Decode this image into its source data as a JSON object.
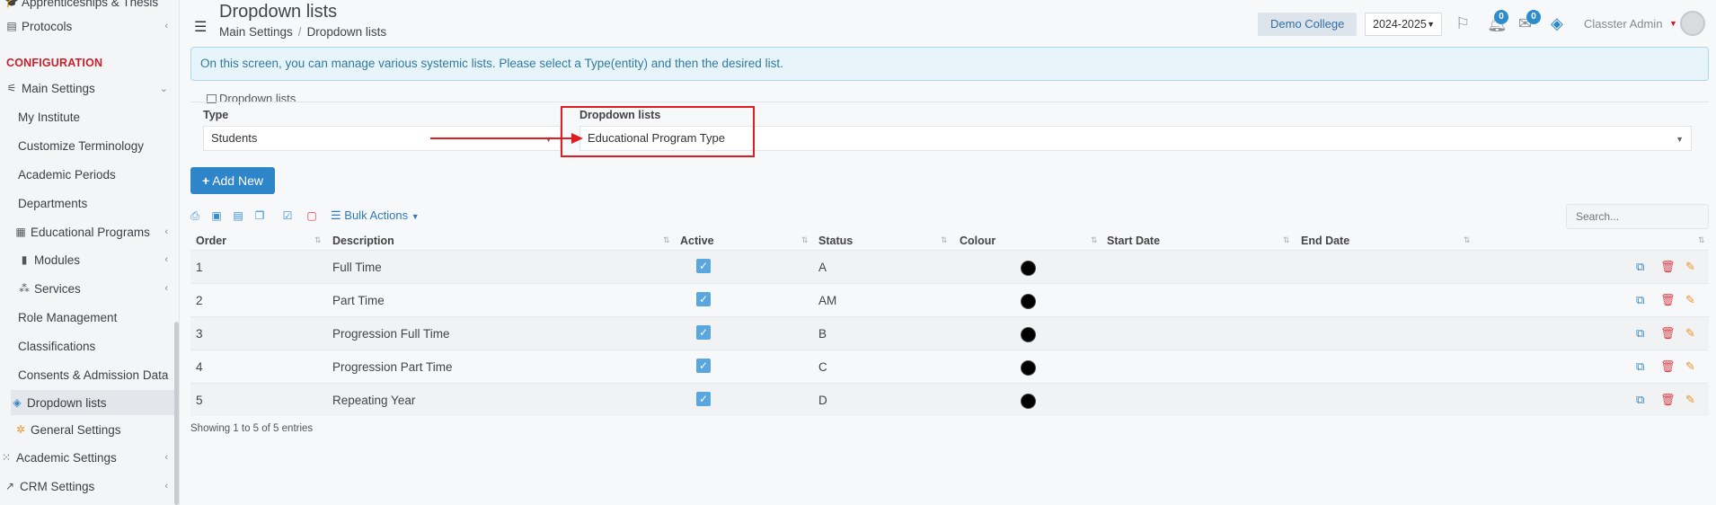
{
  "sidebar": {
    "items": [
      {
        "label": "Apprenticeships & Thesis",
        "icon": "graduation-cap-icon"
      },
      {
        "label": "Protocols",
        "icon": "building-icon"
      },
      {
        "label": "Main Settings",
        "icon": "sliders-icon"
      },
      {
        "label": "My Institute"
      },
      {
        "label": "Customize Terminology"
      },
      {
        "label": "Academic Periods"
      },
      {
        "label": "Departments"
      },
      {
        "label": "Educational Programs",
        "icon": "table-icon"
      },
      {
        "label": "Modules",
        "icon": "book-icon"
      },
      {
        "label": "Services",
        "icon": "nodes-icon"
      },
      {
        "label": "Role Management"
      },
      {
        "label": "Classifications"
      },
      {
        "label": "Consents & Admission Data"
      },
      {
        "label": "Dropdown lists",
        "icon": "layers-icon"
      },
      {
        "label": "General Settings",
        "icon": "cogs-icon"
      },
      {
        "label": "Academic Settings",
        "icon": "grid-icon"
      },
      {
        "label": "CRM Settings",
        "icon": "chart-icon"
      }
    ],
    "section_heading": "CONFIGURATION"
  },
  "header": {
    "title": "Dropdown lists",
    "breadcrumb": [
      "Main Settings",
      "Dropdown lists"
    ],
    "college": "Demo College",
    "year": "2024-2025",
    "notif_count": "0",
    "mail_count": "0",
    "user": "Classter Admin"
  },
  "info": "On this screen, you can manage various systemic lists. Please select a Type(entity) and then the desired list.",
  "panel": {
    "label": "Dropdown lists",
    "type_label": "Type",
    "type_value": "Students",
    "list_label": "Dropdown lists",
    "list_value": "Educational Program Type"
  },
  "actions": {
    "add_new": "Add New",
    "bulk": "Bulk Actions",
    "search_placeholder": "Search..."
  },
  "table": {
    "headers": [
      "Order",
      "Description",
      "Active",
      "Status",
      "Colour",
      "Start Date",
      "End Date"
    ],
    "rows": [
      {
        "order": "1",
        "description": "Full Time",
        "active": true,
        "status": "A",
        "colour": "#000000"
      },
      {
        "order": "2",
        "description": "Part Time",
        "active": true,
        "status": "AM",
        "colour": "#000000"
      },
      {
        "order": "3",
        "description": "Progression Full Time",
        "active": true,
        "status": "B",
        "colour": "#000000"
      },
      {
        "order": "4",
        "description": "Progression Part Time",
        "active": true,
        "status": "C",
        "colour": "#000000"
      },
      {
        "order": "5",
        "description": "Repeating Year",
        "active": true,
        "status": "D",
        "colour": "#000000"
      }
    ],
    "footer": "Showing 1 to 5 of 5 entries"
  },
  "colors": {
    "accent": "#2e86c9",
    "config_heading": "#c9202b",
    "annotation": "#e01b22"
  }
}
